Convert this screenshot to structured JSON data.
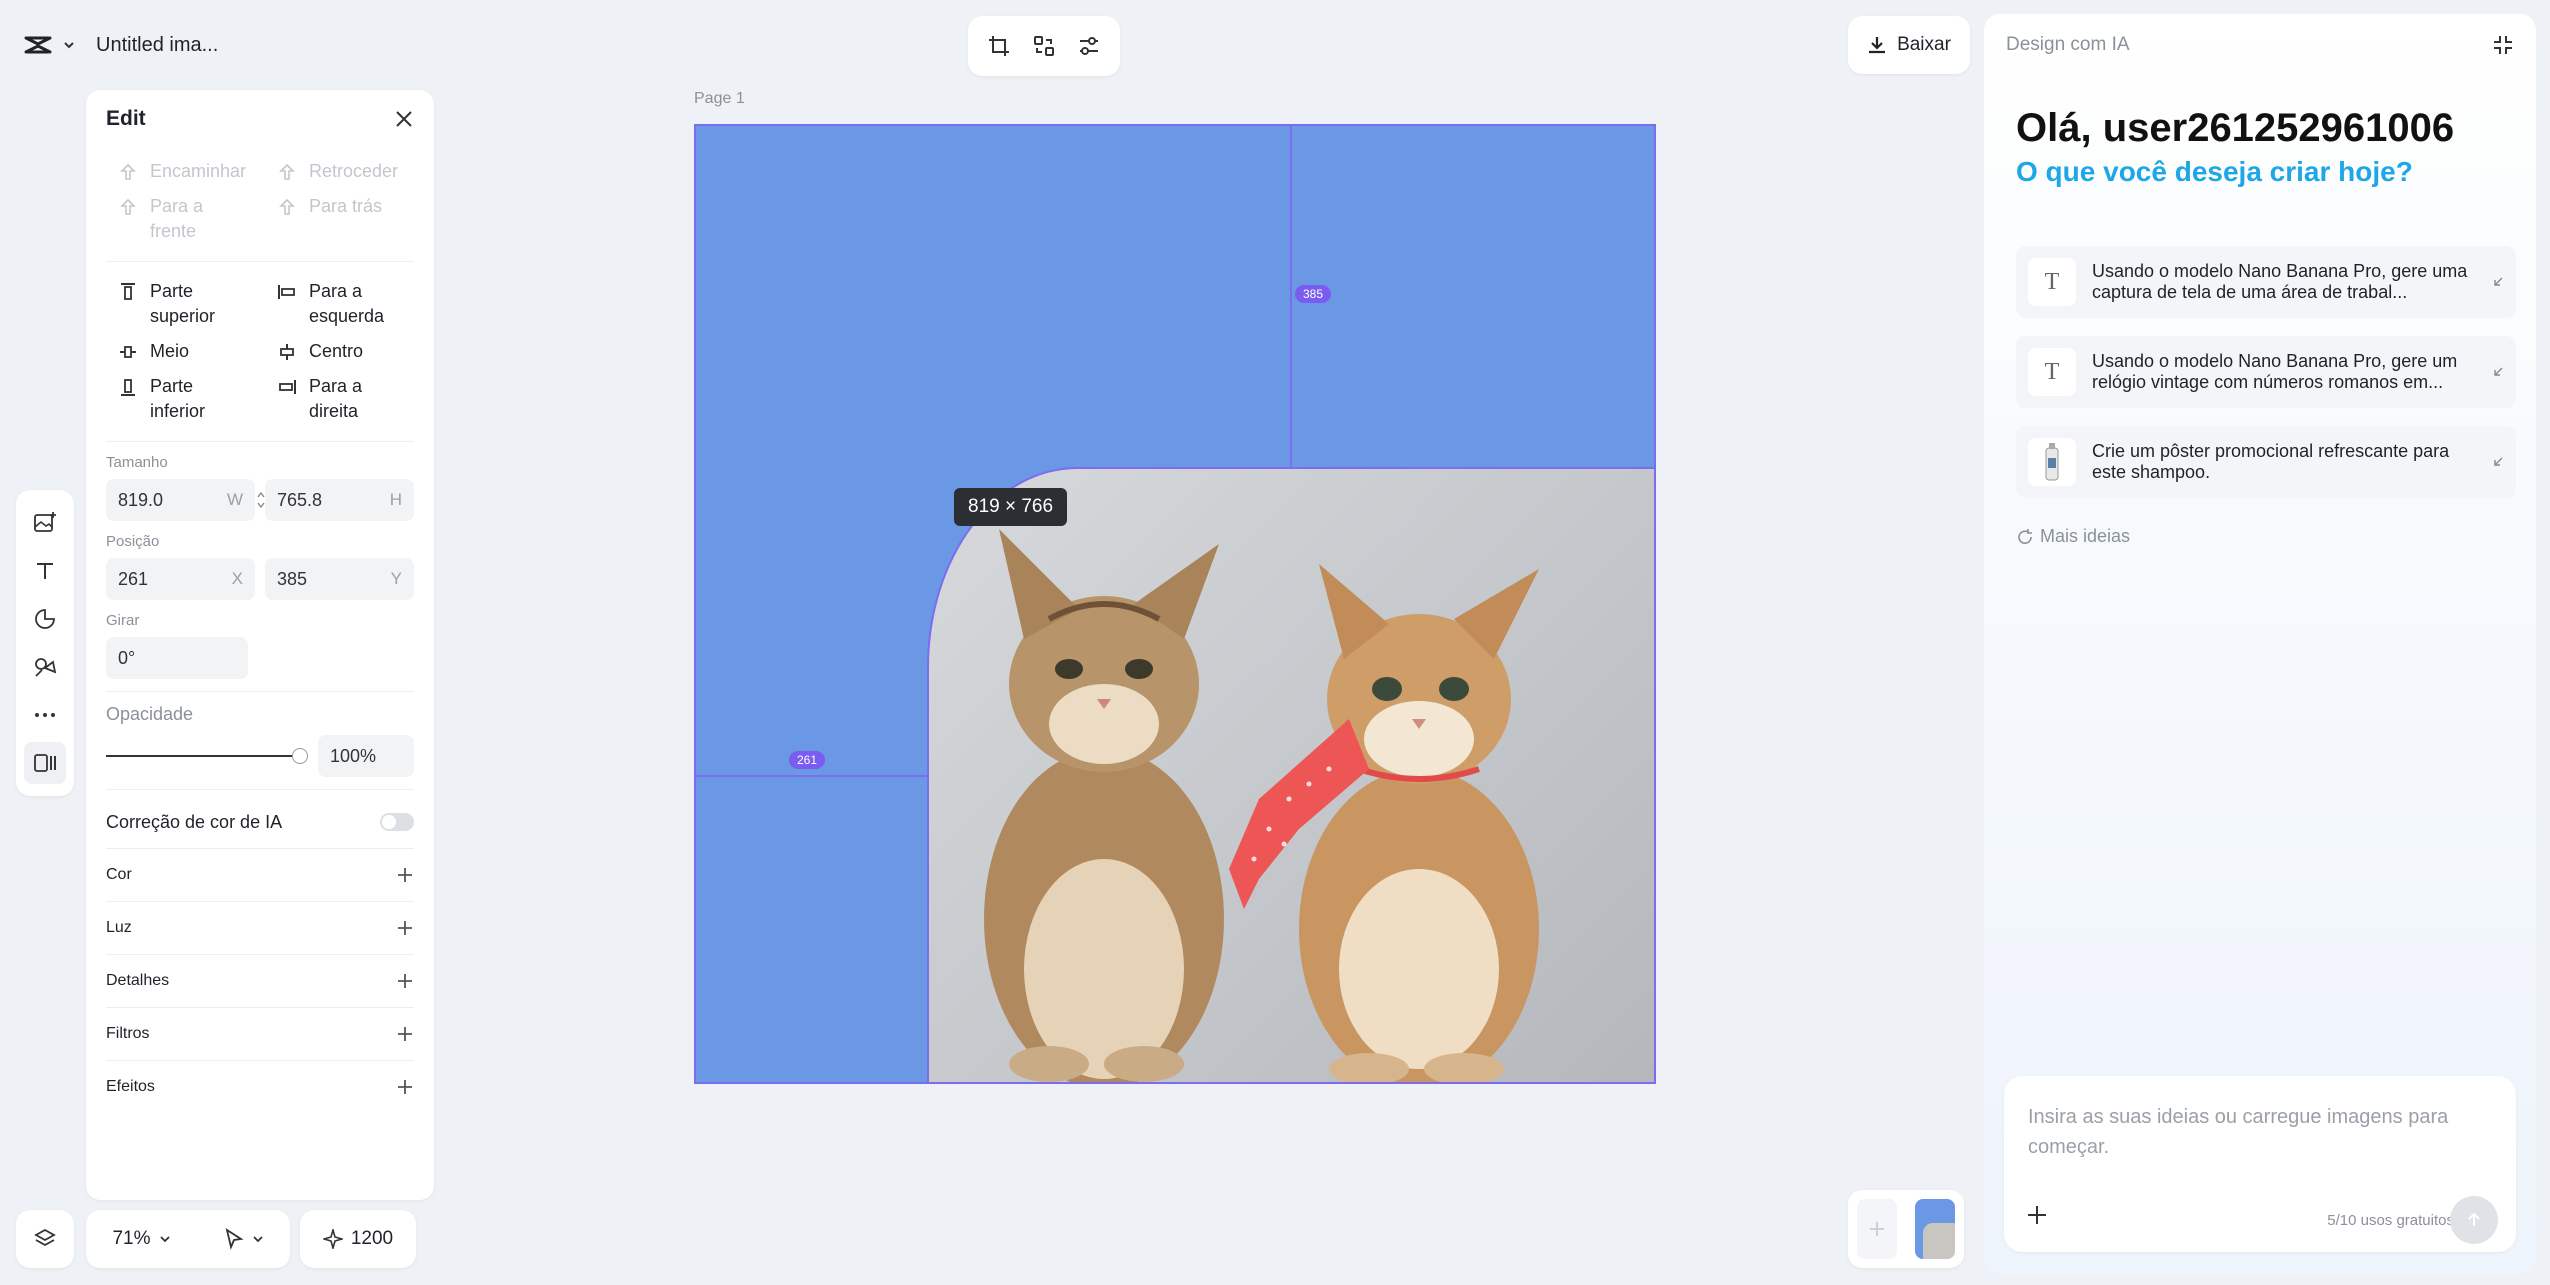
{
  "app": {
    "doc_title": "Untitled ima..."
  },
  "toolbar": {
    "download_label": "Baixar"
  },
  "edit": {
    "title": "Edit",
    "order": [
      {
        "label": "Encaminhar",
        "icon": "bring-forward-icon"
      },
      {
        "label": "Retroceder",
        "icon": "send-backward-icon"
      },
      {
        "label": "Para a frente",
        "icon": "bring-to-front-icon"
      },
      {
        "label": "Para trás",
        "icon": "send-to-back-icon"
      }
    ],
    "align": [
      {
        "label": "Parte superior",
        "icon": "align-top-icon"
      },
      {
        "label": "Para a esquerda",
        "icon": "align-left-icon"
      },
      {
        "label": "Meio",
        "icon": "align-middle-icon"
      },
      {
        "label": "Centro",
        "icon": "align-center-icon"
      },
      {
        "label": "Parte inferior",
        "icon": "align-bottom-icon"
      },
      {
        "label": "Para a direita",
        "icon": "align-right-icon"
      }
    ],
    "size_label": "Tamanho",
    "width": "819.0",
    "width_suffix": "W",
    "height": "765.8",
    "height_suffix": "H",
    "position_label": "Posição",
    "x": "261",
    "x_suffix": "X",
    "y": "385",
    "y_suffix": "Y",
    "rotate_label": "Girar",
    "rotate": "0°",
    "opacity_label": "Opacidade",
    "opacity": "100%",
    "opacity_fraction": 1.0,
    "ai_color_label": "Correção de cor de IA",
    "ai_color_enabled": false,
    "sections": [
      "Cor",
      "Luz",
      "Detalhes",
      "Filtros",
      "Efeitos"
    ]
  },
  "bottom": {
    "zoom": "71%",
    "points": "1200"
  },
  "canvas": {
    "page_label": "Page 1",
    "guide_top": "385",
    "guide_left": "261",
    "size_tooltip": "819 × 766"
  },
  "ai": {
    "header": "Design com IA",
    "greeting": "Olá, user261252961006",
    "subgreeting": "O que você deseja criar hoje?",
    "ideas": [
      {
        "text": "Usando o modelo Nano Banana Pro, gere uma captura de tela de uma área de trabal...",
        "icon": "text-icon",
        "icon_glyph": "T"
      },
      {
        "text": "Usando o modelo Nano Banana Pro, gere um relógio vintage com números romanos em...",
        "icon": "text-icon",
        "icon_glyph": "T"
      },
      {
        "text": "Crie um pôster promocional refrescante para este shampoo.",
        "icon": "shampoo-thumbnail"
      }
    ],
    "more_ideas": "Mais ideias",
    "prompt_placeholder": "Insira as suas ideias ou carregue imagens para começar.",
    "usage": "5/10 usos gratuitos"
  },
  "colors": {
    "canvas_bg": "#6b98e5",
    "accent": "#7b5cf0",
    "subtitle": "#1ea7e6"
  }
}
